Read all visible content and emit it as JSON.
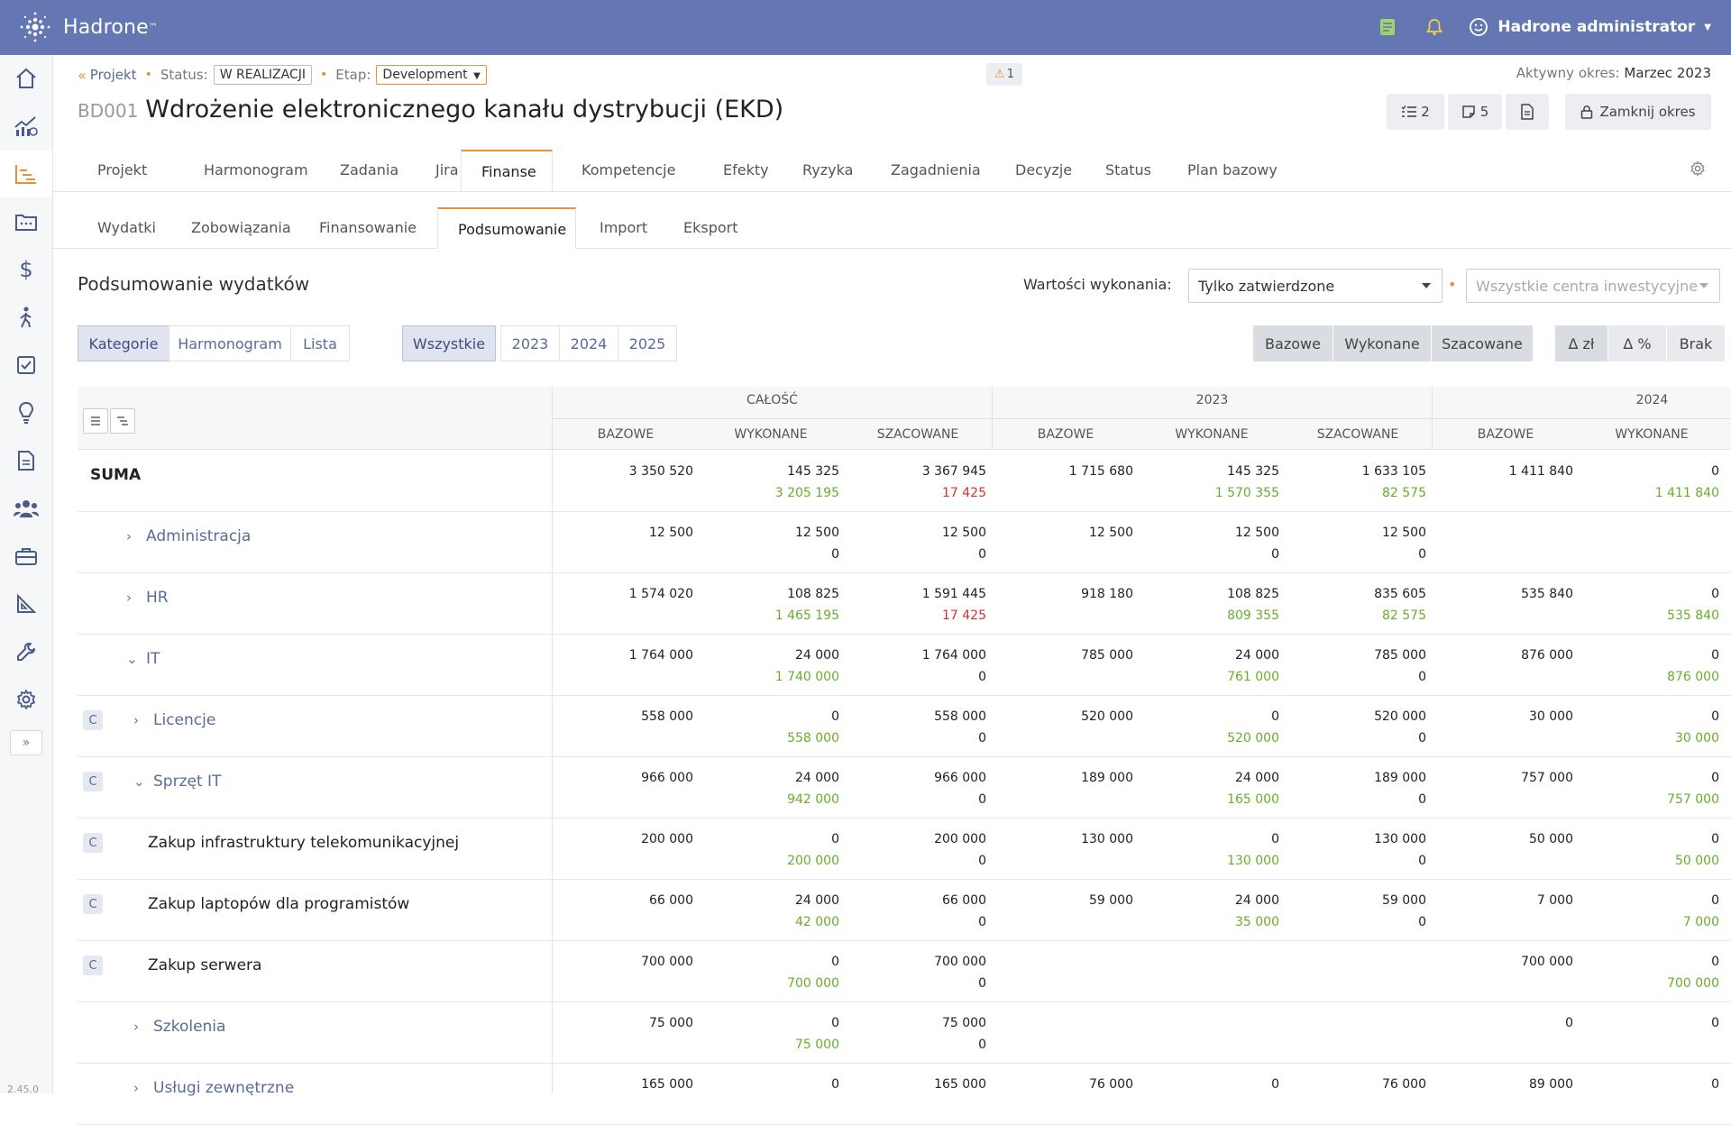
{
  "app": {
    "name": "Hadrone",
    "version": "2.45.0",
    "user": "Hadrone administrator"
  },
  "header": {
    "breadcrumb": "Projekt",
    "status_label": "Status:",
    "status_value": "W REALIZACJI",
    "etap_label": "Etap:",
    "etap_value": "Development",
    "warning_count": "1",
    "period_label": "Aktywny okres:",
    "period_value": "Marzec 2023",
    "code": "BD001",
    "title": "Wdrożenie elektronicznego kanału dystrybucji (EKD)",
    "checklist_count": "2",
    "notes_count": "5",
    "close_period": "Zamknij okres"
  },
  "tabs": [
    "Projekt",
    "Harmonogram",
    "Zadania",
    "Jira",
    "Finanse",
    "Kompetencje",
    "Efekty",
    "Ryzyka",
    "Zagadnienia",
    "Decyzje",
    "Status",
    "Plan bazowy"
  ],
  "active_tab": "Finanse",
  "subtabs": [
    "Wydatki",
    "Zobowiązania",
    "Finansowanie",
    "Podsumowanie",
    "Import",
    "Eksport"
  ],
  "active_subtab": "Podsumowanie",
  "section": {
    "title": "Podsumowanie wydatków",
    "filter_label": "Wartości wykonania:",
    "filter_value": "Tylko zatwierdzone",
    "centers_placeholder": "Wszystkie centra inwestycyjne"
  },
  "view_buttons": [
    "Kategorie",
    "Harmonogram",
    "Lista"
  ],
  "period_buttons": [
    "Wszystkie",
    "2023",
    "2024",
    "2025"
  ],
  "value_buttons": [
    "Bazowe",
    "Wykonane",
    "Szacowane"
  ],
  "delta_buttons": [
    "Δ zł",
    "Δ %",
    "Brak"
  ],
  "table": {
    "groups": [
      "CAŁOŚĆ",
      "2023",
      "2024"
    ],
    "columns": [
      "BAZOWE",
      "WYKONANE",
      "SZACOWANE",
      "BAZOWE",
      "WYKONANE",
      "SZACOWANE",
      "BAZOWE",
      "WYKONANE"
    ],
    "rows": [
      {
        "label": "SUMA",
        "b": [
          "3 350 520",
          "145 325",
          "3 367 945",
          "1 715 680",
          "145 325",
          "1 633 105",
          "1 411 840",
          "0"
        ],
        "d": [
          "",
          "3 205 195",
          "17 425",
          "",
          "1 570 355",
          "82 575",
          "",
          "1 411 840"
        ]
      },
      {
        "label": "Administracja",
        "b": [
          "12 500",
          "12 500",
          "12 500",
          "12 500",
          "12 500",
          "12 500",
          "",
          ""
        ],
        "d": [
          "",
          "0",
          "0",
          "",
          "0",
          "0",
          "",
          ""
        ]
      },
      {
        "label": "HR",
        "b": [
          "1 574 020",
          "108 825",
          "1 591 445",
          "918 180",
          "108 825",
          "835 605",
          "535 840",
          "0"
        ],
        "d": [
          "",
          "1 465 195",
          "17 425",
          "",
          "809 355",
          "82 575",
          "",
          "535 840"
        ]
      },
      {
        "label": "IT",
        "b": [
          "1 764 000",
          "24 000",
          "1 764 000",
          "785 000",
          "24 000",
          "785 000",
          "876 000",
          "0"
        ],
        "d": [
          "",
          "1 740 000",
          "0",
          "",
          "761 000",
          "0",
          "",
          "876 000"
        ]
      },
      {
        "badge": "C",
        "label": "Licencje",
        "b": [
          "558 000",
          "0",
          "558 000",
          "520 000",
          "0",
          "520 000",
          "30 000",
          "0"
        ],
        "d": [
          "",
          "558 000",
          "0",
          "",
          "520 000",
          "0",
          "",
          "30 000"
        ]
      },
      {
        "badge": "C",
        "label": "Sprzęt IT",
        "b": [
          "966 000",
          "24 000",
          "966 000",
          "189 000",
          "24 000",
          "189 000",
          "757 000",
          "0"
        ],
        "d": [
          "",
          "942 000",
          "0",
          "",
          "165 000",
          "0",
          "",
          "757 000"
        ]
      },
      {
        "badge": "C",
        "label": "Zakup infrastruktury telekomunikacyjnej",
        "b": [
          "200 000",
          "0",
          "200 000",
          "130 000",
          "0",
          "130 000",
          "50 000",
          "0"
        ],
        "d": [
          "",
          "200 000",
          "0",
          "",
          "130 000",
          "0",
          "",
          "50 000"
        ]
      },
      {
        "badge": "C",
        "label": "Zakup laptopów dla programistów",
        "b": [
          "66 000",
          "24 000",
          "66 000",
          "59 000",
          "24 000",
          "59 000",
          "7 000",
          "0"
        ],
        "d": [
          "",
          "42 000",
          "0",
          "",
          "35 000",
          "0",
          "",
          "7 000"
        ]
      },
      {
        "badge": "C",
        "label": "Zakup serwera",
        "b": [
          "700 000",
          "0",
          "700 000",
          "",
          "",
          "",
          "700 000",
          "0"
        ],
        "d": [
          "",
          "700 000",
          "0",
          "",
          "",
          "",
          "",
          "700 000"
        ]
      },
      {
        "label": "Szkolenia",
        "b": [
          "75 000",
          "0",
          "75 000",
          "",
          "",
          "",
          "0",
          "0"
        ],
        "d": [
          "",
          "75 000",
          "0",
          "",
          "",
          "",
          "",
          ""
        ]
      },
      {
        "label": "Usługi zewnętrzne",
        "b": [
          "165 000",
          "0",
          "165 000",
          "76 000",
          "0",
          "76 000",
          "89 000",
          "0"
        ],
        "d": [
          "",
          "",
          "",
          "",
          "",
          "",
          "",
          ""
        ]
      }
    ]
  },
  "colors": {
    "topbar": "#6577b3",
    "accent": "#e8903a",
    "positive": "#6aad2a",
    "negative": "#d2312f",
    "link": "#5a6b9a"
  },
  "icons": [
    "hadrone-logo-icon",
    "notes-icon",
    "bell-icon",
    "smiley-icon",
    "home-icon",
    "chart-growth-icon",
    "gantt-icon",
    "folder-icon",
    "dollar-icon",
    "person-walk-icon",
    "checkbox-icon",
    "lightbulb-icon",
    "document-icon",
    "team-icon",
    "briefcase-icon",
    "ruler-icon",
    "wrench-icon",
    "gear-icon",
    "expand-icon"
  ]
}
